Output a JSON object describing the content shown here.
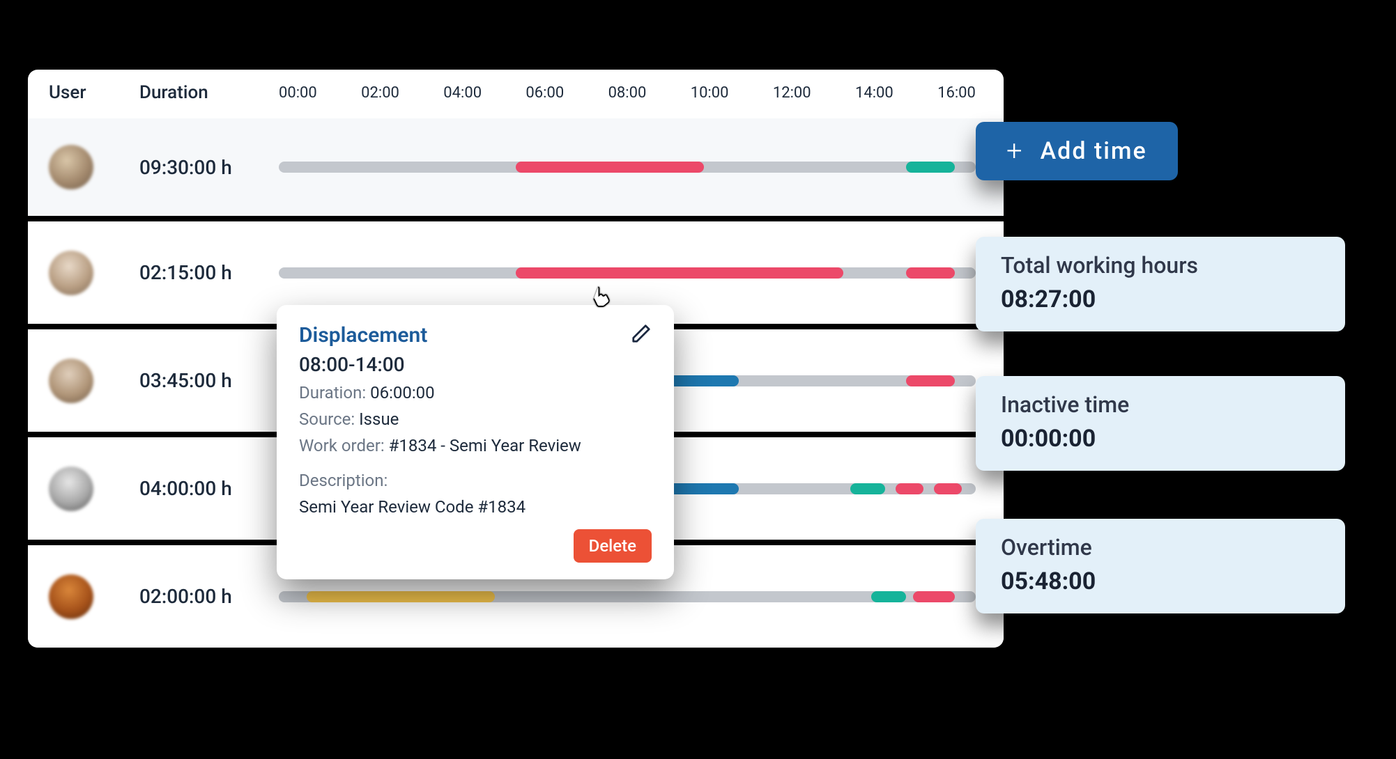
{
  "header": {
    "user": "User",
    "duration": "Duration"
  },
  "ticks": [
    "00:00",
    "02:00",
    "04:00",
    "06:00",
    "08:00",
    "10:00",
    "12:00",
    "14:00",
    "16:00"
  ],
  "rows": [
    {
      "duration": "09:30:00 h"
    },
    {
      "duration": "02:15:00 h"
    },
    {
      "duration": "03:45:00 h"
    },
    {
      "duration": "04:00:00 h"
    },
    {
      "duration": "02:00:00 h"
    }
  ],
  "add_time_label": "Add time",
  "cards": {
    "total": {
      "label": "Total working hours",
      "value": "08:27:00"
    },
    "inactive": {
      "label": "Inactive time",
      "value": "00:00:00"
    },
    "overtime": {
      "label": "Overtime",
      "value": "05:48:00"
    }
  },
  "popover": {
    "title": "Displacement",
    "range": "08:00-14:00",
    "duration_label": "Duration:",
    "duration": "06:00:00",
    "source_label": "Source:",
    "source": "Issue",
    "work_order_label": "Work order:",
    "work_order": "#1834 - Semi Year Review",
    "description_label": "Description:",
    "description": "Semi Year Review Code #1834",
    "delete_label": "Delete"
  }
}
